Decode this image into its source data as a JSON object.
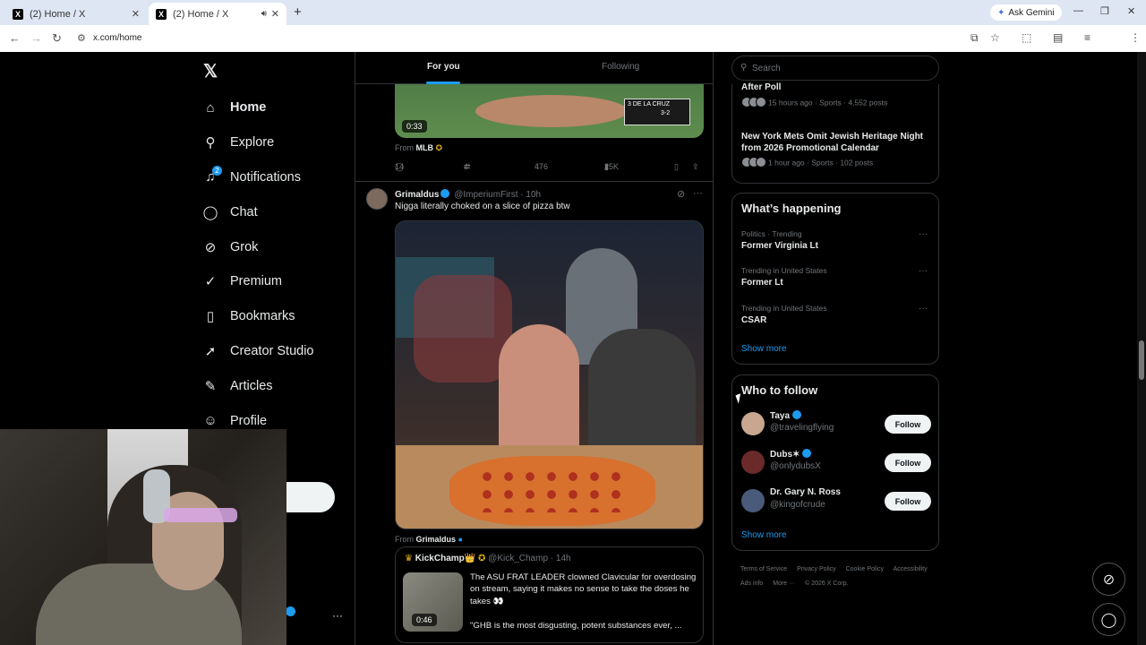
{
  "browser": {
    "tabs": [
      {
        "title": "(2) Home / X",
        "favicon": "X"
      },
      {
        "title": "(2) Home / X",
        "favicon": "X"
      }
    ],
    "url": "x.com/home",
    "gemini": "Ask Gemini"
  },
  "nav": {
    "items": [
      {
        "label": "Home",
        "icon": "home-icon"
      },
      {
        "label": "Explore",
        "icon": "search-icon"
      },
      {
        "label": "Notifications",
        "icon": "bell-icon",
        "badge": "2"
      },
      {
        "label": "Chat",
        "icon": "chat-icon"
      },
      {
        "label": "Grok",
        "icon": "grok-icon"
      },
      {
        "label": "Premium",
        "icon": "premium-icon"
      },
      {
        "label": "Bookmarks",
        "icon": "bookmark-icon"
      },
      {
        "label": "Creator Studio",
        "icon": "rocket-icon"
      },
      {
        "label": "Articles",
        "icon": "article-icon"
      },
      {
        "label": "Profile",
        "icon": "person-icon"
      }
    ]
  },
  "feed": {
    "tabs": [
      "For you",
      "Following"
    ],
    "post1": {
      "duration": "0:33",
      "from_label": "From",
      "from_name": "MLB",
      "replies": "14",
      "reposts": "4",
      "likes": "476",
      "views": "25K",
      "scoreboard": {
        "label": "3 DE LA CRUZ",
        "count": "3-2"
      }
    },
    "post2": {
      "name": "Grimaldus",
      "handle": "@ImperiumFirst",
      "time": "· 10h",
      "text": "Nigga literally choked on a slice of pizza btw",
      "from_label": "From",
      "from_name": "Grimaldus"
    },
    "quote": {
      "name": "KickChamp👑",
      "handle": "@Kick_Champ",
      "time": "· 14h",
      "text": "The ASU FRAT LEADER clowned Clavicular for overdosing on stream, saying it makes no sense to take the doses he takes 👀",
      "text2": "\"GHB is the most disgusting, potent substances ever, ...",
      "duration": "0:46"
    }
  },
  "sidebar": {
    "search_placeholder": "Search",
    "trends_top": [
      {
        "title": "After Poll",
        "meta": "15 hours ago · Sports · 4,552 posts"
      },
      {
        "title": "New York Mets Omit Jewish Heritage Night from 2026 Promotional Calendar",
        "meta": "1 hour ago · Sports · 102 posts"
      }
    ],
    "happening": {
      "title": "What’s happening",
      "items": [
        {
          "meta": "Politics · Trending",
          "title": "Former Virginia Lt"
        },
        {
          "meta": "Trending in United States",
          "title": "Former Lt"
        },
        {
          "meta": "Trending in United States",
          "title": "CSAR"
        }
      ],
      "show_more": "Show more"
    },
    "who_to_follow": {
      "title": "Who to follow",
      "users": [
        {
          "name": "Taya",
          "handle": "@travelingflying",
          "button": "Follow"
        },
        {
          "name": "Dubs✶",
          "handle": "@onlydubsX",
          "button": "Follow"
        },
        {
          "name": "Dr. Gary N. Ross",
          "handle": "@kingofcrude",
          "button": "Follow"
        }
      ],
      "show_more": "Show more"
    },
    "footer": [
      "Terms of Service",
      "Privacy Policy",
      "Cookie Policy",
      "Accessibility",
      "Ads info",
      "More ···",
      "© 2026 X Corp."
    ]
  },
  "colors": {
    "accent": "#1d9bf0",
    "background": "#000000",
    "border": "#2f3336",
    "muted": "#71767b"
  }
}
